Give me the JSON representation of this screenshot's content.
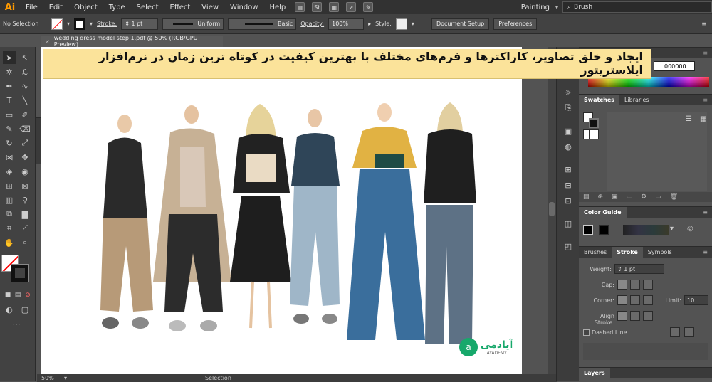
{
  "app": {
    "logo": "Ai"
  },
  "menubar": {
    "items": [
      "File",
      "Edit",
      "Object",
      "Type",
      "Select",
      "Effect",
      "View",
      "Window",
      "Help"
    ],
    "icons": [
      "St"
    ],
    "workspace": "Painting",
    "search_value": "Brush"
  },
  "control_bar": {
    "selection": "No Selection",
    "stroke_label": "Stroke:",
    "stroke_value": "1 pt",
    "profile": "Uniform",
    "brush": "Basic",
    "opacity_label": "Opacity:",
    "opacity_value": "100%",
    "style_label": "Style:",
    "doc_setup": "Document Setup",
    "preferences": "Preferences"
  },
  "document": {
    "tab_title": "wedding dress model step 1.pdf @ 50% (RGB/GPU Preview)",
    "tab_close": "×",
    "zoom": "50%",
    "status_mode": "Selection",
    "watermark": "آیادمی",
    "watermark_sub": "AYADEMY"
  },
  "banner": {
    "text": "ایجاد و خلق تصاویر، کاراکترها و فرم‌های مختلف با بهترین کیفیت در کوتاه ترین زمان در نرم‌افزار ایلاستریتور"
  },
  "color_panel": {
    "hash": "#",
    "hex_value": "000000"
  },
  "swatches_panel": {
    "tabs": [
      "Swatches",
      "Libraries"
    ]
  },
  "color_guide": {
    "title": "Color Guide"
  },
  "stroke_panel": {
    "tabs": [
      "Brushes",
      "Stroke",
      "Symbols"
    ],
    "weight_label": "Weight:",
    "weight_value": "1 pt",
    "cap_label": "Cap:",
    "corner_label": "Corner:",
    "limit_label": "Limit:",
    "limit_value": "10",
    "align_label": "Align Stroke:",
    "dashed_label": "Dashed Line"
  },
  "layers_panel": {
    "title": "Layers"
  },
  "colors": {
    "banner": "#fbe39a",
    "accent": "#ff9a00",
    "ui_dark": "#323232",
    "ui_mid": "#535353"
  }
}
